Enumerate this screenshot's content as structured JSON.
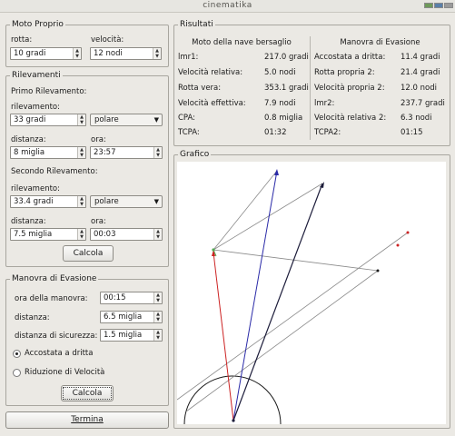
{
  "window": {
    "title": "cinematika"
  },
  "moto_proprio": {
    "legend": "Moto Proprio",
    "rotta_label": "rotta:",
    "rotta_value": "10 gradi",
    "velocita_label": "velocità:",
    "velocita_value": "12 nodi"
  },
  "rilevamenti": {
    "legend": "Rilevamenti",
    "primo": {
      "heading": "Primo Rilevamento:",
      "rilevamento_label": "rilevamento:",
      "rilevamento_value": "33 gradi",
      "mode_value": "polare",
      "distanza_label": "distanza:",
      "distanza_value": "8 miglia",
      "ora_label": "ora:",
      "ora_value": "23:57"
    },
    "secondo": {
      "heading": "Secondo Rilevamento:",
      "rilevamento_label": "rilevamento:",
      "rilevamento_value": "33.4 gradi",
      "mode_value": "polare",
      "distanza_label": "distanza:",
      "distanza_value": "7.5 miglia",
      "ora_label": "ora:",
      "ora_value": "00:03"
    },
    "calcola_label": "Calcola"
  },
  "manovra": {
    "legend": "Manovra di Evasione",
    "ora_label": "ora della manovra:",
    "ora_value": "00:15",
    "distanza_label": "distanza:",
    "distanza_value": "6.5 miglia",
    "sicurezza_label": "distanza di sicurezza:",
    "sicurezza_value": "1.5 miglia",
    "option_accostata": "Accostata a dritta",
    "option_riduzione": "Riduzione di Velocità",
    "selected": "accostata",
    "calcola_label": "Calcola"
  },
  "termina_label": "Termina",
  "risultati": {
    "legend": "Risultati",
    "left_heading": "Moto della nave bersaglio",
    "right_heading": "Manovra di Evasione",
    "left_rows": [
      {
        "k": "lmr1:",
        "v": "217.0 gradi"
      },
      {
        "k": "Velocità relativa:",
        "v": "5.0 nodi"
      },
      {
        "k": "Rotta vera:",
        "v": "353.1 gradi"
      },
      {
        "k": "Velocità effettiva:",
        "v": "7.9 nodi"
      },
      {
        "k": "CPA:",
        "v": "0.8 miglia"
      },
      {
        "k": "TCPA:",
        "v": "01:32"
      }
    ],
    "right_rows": [
      {
        "k": "Accostata a dritta:",
        "v": "11.4 gradi"
      },
      {
        "k": "Rotta propria 2:",
        "v": "21.4 gradi"
      },
      {
        "k": "Velocità propria 2:",
        "v": "12.0 nodi"
      },
      {
        "k": "lmr2:",
        "v": "237.7 gradi"
      },
      {
        "k": "Velocità relativa 2:",
        "v": "6.3 nodi"
      },
      {
        "k": "TCPA2:",
        "v": "01:15"
      }
    ]
  },
  "grafico": {
    "legend": "Grafico"
  },
  "colors": {
    "red": "#cc2222",
    "blue": "#2a2aa8",
    "dark": "#1c1c3a",
    "gray": "#8a8a8a"
  }
}
